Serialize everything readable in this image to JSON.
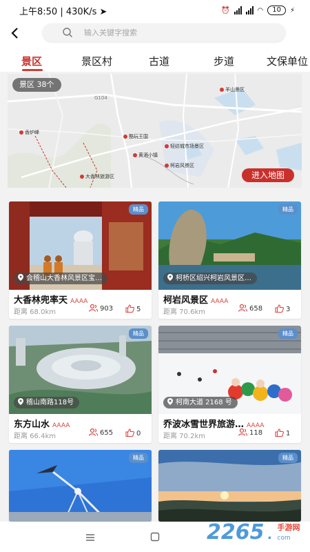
{
  "status_bar": {
    "time": "上午8:50",
    "speed": "430K/s",
    "battery": "10"
  },
  "search": {
    "placeholder": "输入关键字搜索"
  },
  "tabs": [
    "景区",
    "景区村",
    "古道",
    "步道",
    "文保单位"
  ],
  "active_tab": "景区",
  "map": {
    "count_label": "景区  38个",
    "enter_button": "进入地图",
    "labels": [
      "羊山景区",
      "柯岩风景区",
      "轻纺城市场景区",
      "酷玩王国",
      "黄酒小镇",
      "大香林旅游区",
      "香炉峰",
      "G104"
    ]
  },
  "cards": [
    {
      "title": "大香林兜率天",
      "level": "AAAA",
      "location": "会稽山大香林风景区宝…",
      "distance": "距离 68.0km",
      "views": "903",
      "likes": "5",
      "badge": "精品"
    },
    {
      "title": "柯岩风景区",
      "level": "AAAA",
      "location": "柯桥区绍兴柯岩风景区…",
      "distance": "距离 70.6km",
      "views": "658",
      "likes": "3",
      "badge": "精品"
    },
    {
      "title": "东方山水",
      "level": "AAAA",
      "location": "稽山南路118号",
      "distance": "距离 66.4km",
      "views": "655",
      "likes": "0",
      "badge": "精品"
    },
    {
      "title": "乔波冰雪世界旅游…",
      "level": "AAAA",
      "location": "柯南大道 2168 号",
      "distance": "距离 70.2km",
      "views": "118",
      "likes": "1",
      "badge": "精品"
    },
    {
      "badge": "精品"
    },
    {
      "badge": "精品"
    }
  ],
  "watermark": {
    "number": "2265",
    "dot": ".",
    "cn": "手游网",
    "com": "com"
  },
  "colors": {
    "accent": "#c9302c",
    "badge": "#5b8fcb"
  }
}
